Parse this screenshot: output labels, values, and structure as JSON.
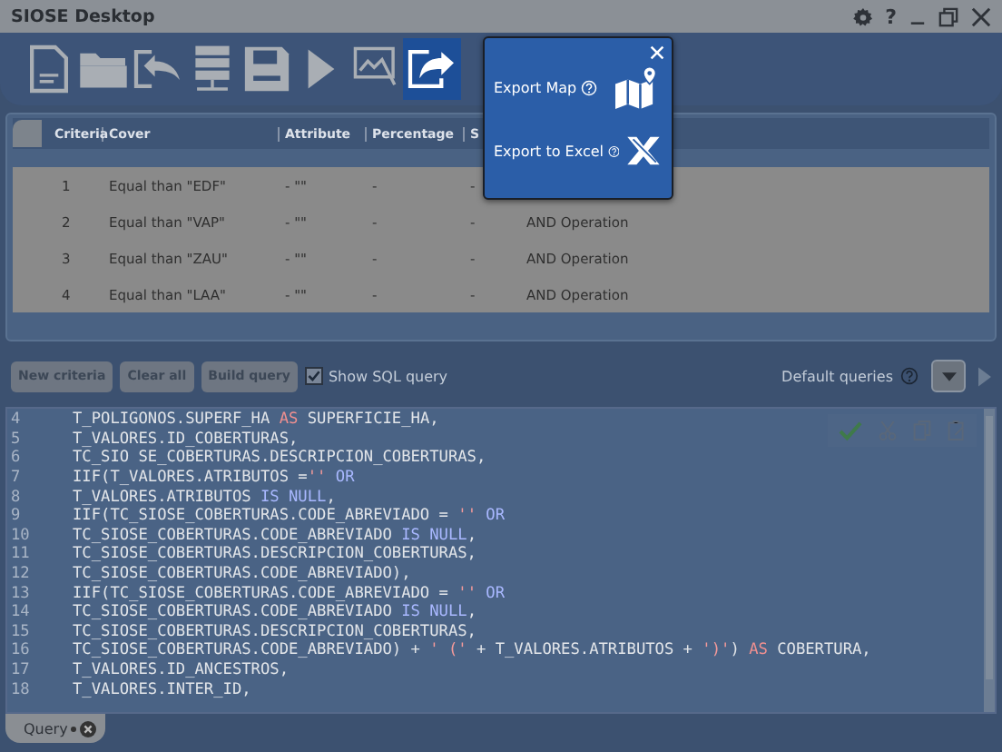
{
  "window": {
    "title": "SIOSE Desktop",
    "help": "?"
  },
  "toolbar": [
    {
      "kind": "new-file",
      "selected": false
    },
    {
      "kind": "open-folder",
      "selected": false
    },
    {
      "kind": "import",
      "selected": false
    },
    {
      "kind": "server",
      "selected": false
    },
    {
      "kind": "save",
      "selected": false
    },
    {
      "kind": "run",
      "selected": false
    },
    {
      "kind": "chart",
      "selected": false
    },
    {
      "kind": "export",
      "selected": true
    }
  ],
  "export_popup": {
    "items": [
      {
        "label": "Export Map",
        "kind": "map"
      },
      {
        "label": "Export to Excel",
        "kind": "excel"
      }
    ]
  },
  "table": {
    "columns": [
      "Criteria",
      "Cover",
      "Attribute",
      "Percentage",
      "S"
    ],
    "rows": [
      {
        "cells": [
          "1",
          "Equal than \"EDF\"",
          "- \"\"",
          "-",
          "-"
        ]
      },
      {
        "cells": [
          "2",
          "Equal than \"VAP\"",
          "- \"\"",
          "-",
          "-"
        ],
        "operation": "AND Operation"
      },
      {
        "cells": [
          "3",
          "Equal than \"ZAU\"",
          "- \"\"",
          "-",
          "-"
        ],
        "operation": "AND Operation"
      },
      {
        "cells": [
          "4",
          "Equal than \"LAA\"",
          "- \"\"",
          "-",
          "-"
        ],
        "operation": "AND Operation"
      }
    ]
  },
  "actions": {
    "buttons": [
      "New criteria",
      "Clear all",
      "Build query"
    ],
    "show_sql": {
      "label": "Show SQL query",
      "checked": true
    },
    "default_queries": "Default queries"
  },
  "code": [
    {
      "num": "4",
      "parts": [
        {
          "t": "T_POLIGONOS.SUPERF_HA ",
          "kind": "text"
        },
        {
          "t": "AS",
          "kind": "as"
        },
        {
          "t": " SUPERFICIE_HA,",
          "kind": "text"
        }
      ]
    },
    {
      "num": "5",
      "parts": [
        {
          "t": "T_VALORES.ID_COBERTURAS,",
          "kind": "text"
        }
      ]
    },
    {
      "num": "6",
      "parts": [
        {
          "t": "TC_SIO SE_COBERTURAS.DESCRIPCION_COBERTURAS,",
          "kind": "text"
        }
      ]
    },
    {
      "num": "7",
      "parts": [
        {
          "t": "IIF(T_VALORES.ATRIBUTOS =",
          "kind": "text"
        },
        {
          "t": "''",
          "kind": "string"
        },
        {
          "t": " OR",
          "kind": "op"
        }
      ]
    },
    {
      "num": "8",
      "parts": [
        {
          "t": "T_VALORES.ATRIBUTOS ",
          "kind": "text"
        },
        {
          "t": "IS NULL",
          "kind": "op"
        },
        {
          "t": ",",
          "kind": "text"
        }
      ]
    },
    {
      "num": "9",
      "parts": [
        {
          "t": "IIF(TC_SIOSE_COBERTURAS.CODE_ABREVIADO = ",
          "kind": "text"
        },
        {
          "t": "''",
          "kind": "string"
        },
        {
          "t": " OR",
          "kind": "op"
        }
      ]
    },
    {
      "num": "10",
      "parts": [
        {
          "t": "TC_SIOSE_COBERTURAS.CODE_ABREVIADO ",
          "kind": "text"
        },
        {
          "t": "IS NULL",
          "kind": "op"
        },
        {
          "t": ",",
          "kind": "text"
        }
      ]
    },
    {
      "num": "11",
      "parts": [
        {
          "t": "TC_SIOSE_COBERTURAS.DESCRIPCION_COBERTURAS,",
          "kind": "text"
        }
      ]
    },
    {
      "num": "12",
      "parts": [
        {
          "t": "TC_SIOSE_COBERTURAS.CODE_ABREVIADO),",
          "kind": "text"
        }
      ]
    },
    {
      "num": "13",
      "parts": [
        {
          "t": "IIF(TC_SIOSE_COBERTURAS.CODE_ABREVIADO = ",
          "kind": "text"
        },
        {
          "t": "''",
          "kind": "string"
        },
        {
          "t": " OR",
          "kind": "op"
        }
      ]
    },
    {
      "num": "14",
      "parts": [
        {
          "t": "TC_SIOSE_COBERTURAS.CODE_ABREVIADO ",
          "kind": "text"
        },
        {
          "t": "IS NULL",
          "kind": "op"
        },
        {
          "t": ",",
          "kind": "text"
        }
      ]
    },
    {
      "num": "15",
      "parts": [
        {
          "t": "TC_SIOSE_COBERTURAS.DESCRIPCION_COBERTURAS,",
          "kind": "text"
        }
      ]
    },
    {
      "num": "16",
      "parts": [
        {
          "t": "TC_SIOSE_COBERTURAS.CODE_ABREVIADO) + ",
          "kind": "text"
        },
        {
          "t": "' ('",
          "kind": "string"
        },
        {
          "t": " + T_VALORES.ATRIBUTOS + ",
          "kind": "text"
        },
        {
          "t": "')'",
          "kind": "string"
        },
        {
          "t": ") ",
          "kind": "text"
        },
        {
          "t": "AS",
          "kind": "as"
        },
        {
          "t": " COBERTURA,",
          "kind": "text"
        }
      ]
    },
    {
      "num": "17",
      "parts": [
        {
          "t": "T_VALORES.ID_ANCESTROS,",
          "kind": "text"
        }
      ]
    },
    {
      "num": "18",
      "parts": [
        {
          "t": "T_VALORES.INTER_ID,",
          "kind": "text"
        }
      ]
    }
  ],
  "tabs": [
    {
      "label": "Query",
      "selected": true
    }
  ]
}
